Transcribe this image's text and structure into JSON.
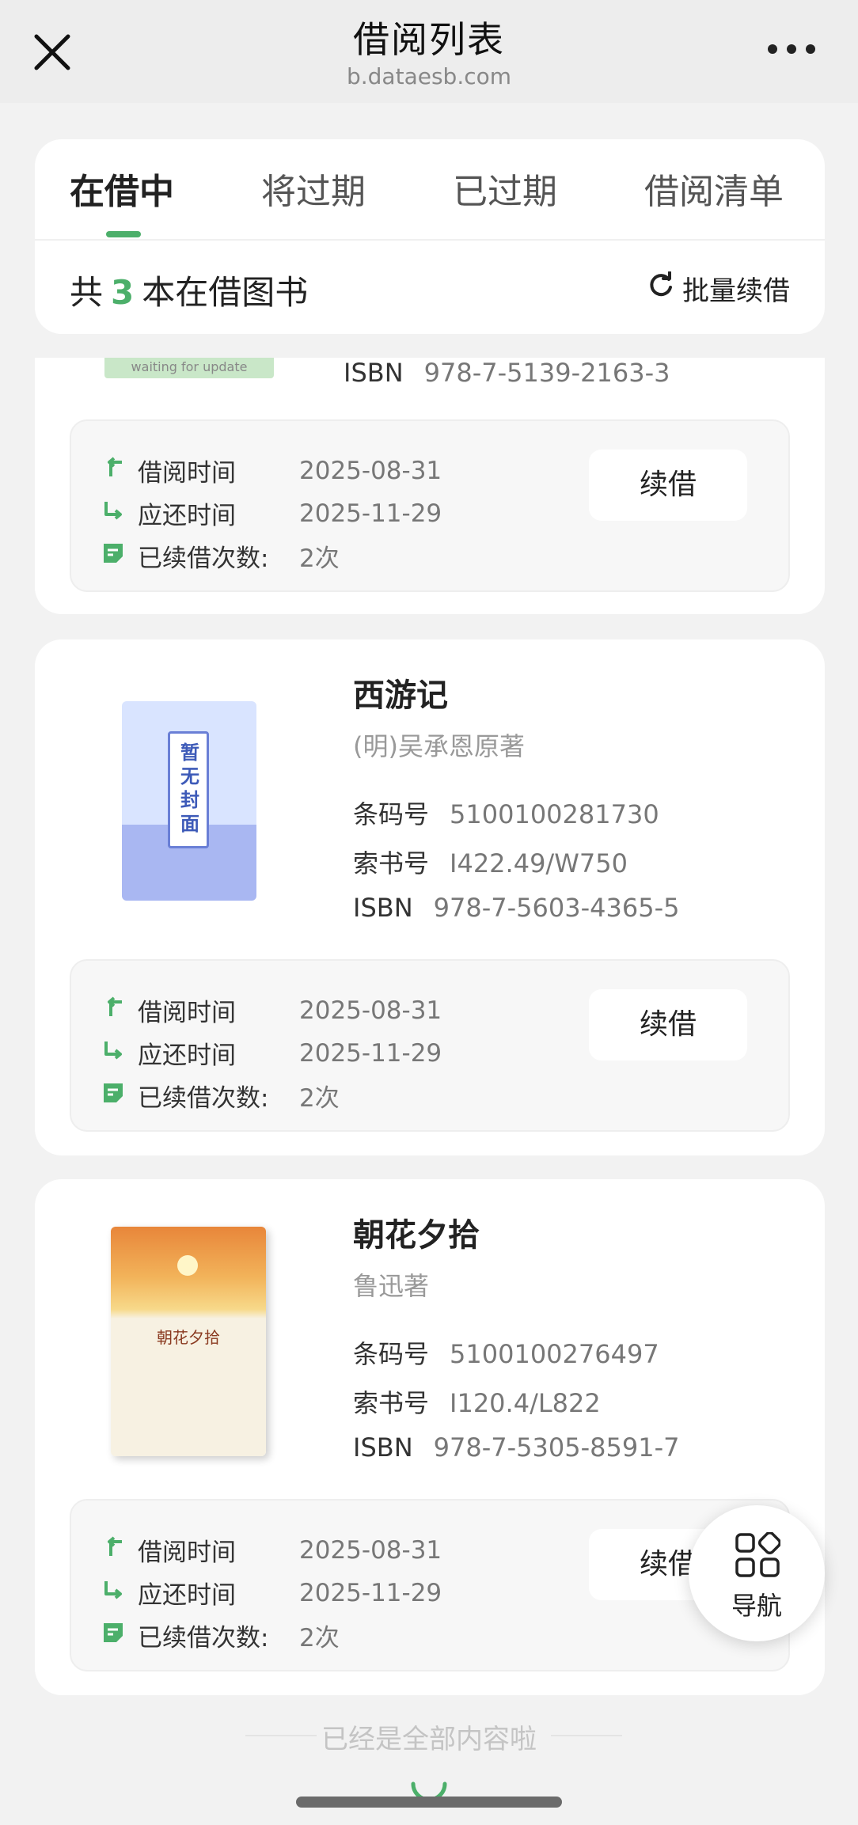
{
  "header": {
    "title": "借阅列表",
    "url": "b.dataesb.com"
  },
  "tabs": [
    {
      "label": "在借中",
      "active": true
    },
    {
      "label": "将过期",
      "active": false
    },
    {
      "label": "已过期",
      "active": false
    },
    {
      "label": "借阅清单",
      "active": false
    }
  ],
  "summary": {
    "prefix": "共",
    "count": "3",
    "suffix": "本在借图书",
    "batch_renew": "批量续借"
  },
  "labels": {
    "barcode": "条码号",
    "call_number": "索书号",
    "isbn": "ISBN",
    "borrow_date": "借阅时间",
    "due_date": "应还时间",
    "renew_count": "已续借次数:",
    "renew_button": "续借"
  },
  "books": [
    {
      "cover_text": "waiting for update",
      "isbn": "978-7-5139-2163-3",
      "borrow_date": "2025-08-31",
      "due_date": "2025-11-29",
      "renew_count": "2次"
    },
    {
      "title": "西游记",
      "author": "(明)吴承恩原著",
      "cover_text": "暂无封面",
      "barcode": "5100100281730",
      "call_number": "I422.49/W750",
      "isbn": "978-7-5603-4365-5",
      "borrow_date": "2025-08-31",
      "due_date": "2025-11-29",
      "renew_count": "2次"
    },
    {
      "title": "朝花夕拾",
      "author": "鲁迅著",
      "cover_text": "朝花夕拾",
      "barcode": "5100100276497",
      "call_number": "I120.4/L822",
      "isbn": "978-7-5305-8591-7",
      "borrow_date": "2025-08-31",
      "due_date": "2025-11-29",
      "renew_count": "2次"
    }
  ],
  "footer": {
    "end_text": "已经是全部内容啦"
  },
  "nav_fab": {
    "label": "导航"
  },
  "colors": {
    "accent": "#4caf6a",
    "page_bg": "#f2f2f2",
    "card_bg": "#ffffff"
  },
  "icons": [
    "close-icon",
    "more-icon",
    "refresh-icon",
    "borrow-arrow-icon",
    "return-arrow-icon",
    "renew-note-icon",
    "grid-nav-icon"
  ]
}
